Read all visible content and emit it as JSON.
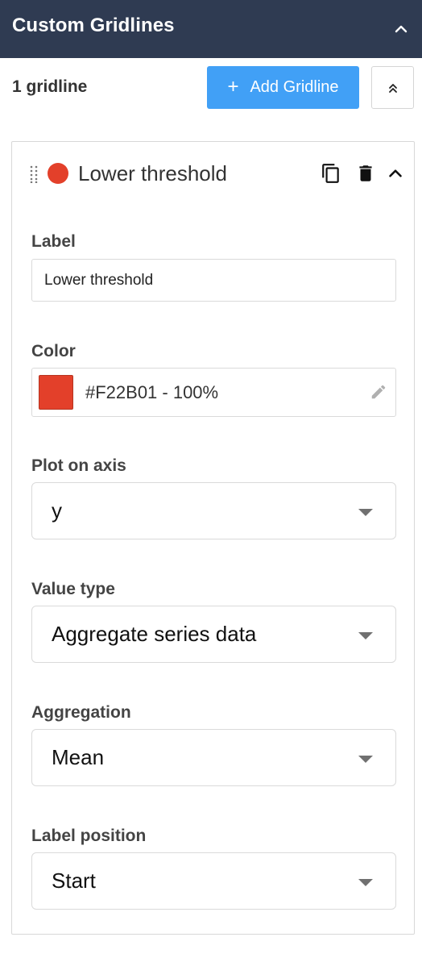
{
  "header": {
    "title": "Custom Gridlines"
  },
  "toolbar": {
    "count_label": "1 gridline",
    "add_label": "Add Gridline",
    "add_plus": "+"
  },
  "gridline": {
    "title": "Lower threshold",
    "color_hex": "#E3402A",
    "label_field": {
      "label": "Label",
      "value": "Lower threshold"
    },
    "color_field": {
      "label": "Color",
      "value": "#F22B01 - 100%"
    },
    "axis_field": {
      "label": "Plot on axis",
      "value": "y"
    },
    "value_type_field": {
      "label": "Value type",
      "value": "Aggregate series data"
    },
    "aggregation_field": {
      "label": "Aggregation",
      "value": "Mean"
    },
    "label_position_field": {
      "label": "Label position",
      "value": "Start"
    }
  },
  "icons": [
    "chevron-up-icon",
    "double-chevron-up-icon",
    "drag-handle-icon",
    "copy-icon",
    "trash-icon",
    "pencil-icon",
    "caret-down-icon"
  ],
  "colors": {
    "header": "#2F3B52",
    "primary_button": "#41A0F6",
    "swatch": "#E3402A"
  }
}
